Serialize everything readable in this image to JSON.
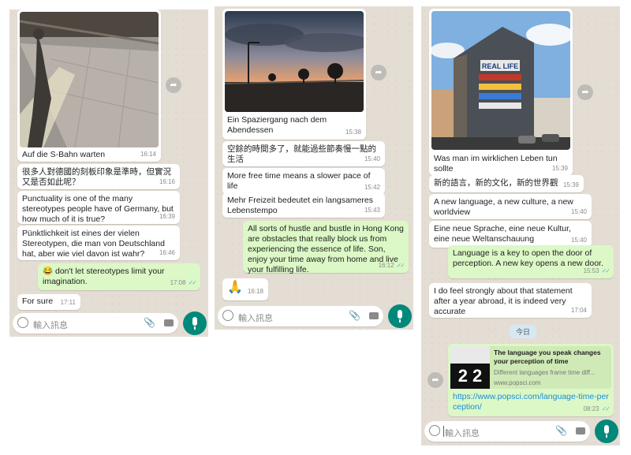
{
  "panel1": {
    "caption": "Auf die S-Bahn warten",
    "caption_time": "16:14",
    "messages": [
      {
        "text": "很多人對德國的刻板印象是準時，但實況又是否如此呢？",
        "time": "16:16"
      },
      {
        "text": "Punctuality is one of the many stereotypes people have of Germany, but how much of it is true?",
        "time": "16:39"
      },
      {
        "text": "Pünktlichkeit ist eines der vielen Stereotypen, die man von Deutschland hat, aber wie viel davon ist wahr?",
        "time": "16:46"
      },
      {
        "text": "😂 don't let stereotypes limit your imagination.",
        "time": "17:08"
      },
      {
        "text": "For sure",
        "time": "17:11"
      }
    ],
    "input_placeholder": "輸入訊息"
  },
  "panel2": {
    "caption": "Ein Spaziergang nach dem Abendessen",
    "caption_time": "15:38",
    "messages": [
      {
        "text": "空餘的時間多了，就能過些節奏慢一點的生活",
        "time": "15:40"
      },
      {
        "text": "More free time means a slower pace of life",
        "time": "15:42"
      },
      {
        "text": "Mehr Freizeit bedeutet ein langsameres Lebenstempo",
        "time": "15:43"
      },
      {
        "text": "All sorts of hustle and bustle in Hong Kong are obstacles that really block us from experiencing the essence of life. Son, enjoy your time away from home and live your fulfilling life.",
        "time": "16:12"
      },
      {
        "text": "🙏",
        "time": "16:18"
      }
    ],
    "input_placeholder": "輸入訊息"
  },
  "panel3": {
    "caption": "Was man im wirklichen Leben tun sollte",
    "caption_time": "15:39",
    "photo_sign": "REAL LIFE",
    "messages": [
      {
        "text": "新的語言，新的文化，新的世界觀",
        "time": "15:39"
      },
      {
        "text": "A new language, a new culture, a new worldview",
        "time": "15:40"
      },
      {
        "text": "Eine neue Sprache, eine neue Kultur, eine neue Weltanschauung",
        "time": "15:40"
      },
      {
        "text": "Language is a key to open the door of perception. A new key opens a new door.",
        "time": "15:53"
      },
      {
        "text": "I do feel strongly about that statement after a year abroad, it is indeed very accurate",
        "time": "17:04"
      }
    ],
    "date_chip": "今日",
    "link": {
      "title": "The language you speak changes your perception of time",
      "desc": "Different languages frame time diff...",
      "domain": "www.popsci.com",
      "url": "https://www.popsci.com/language-time-perception/",
      "time": "08:23",
      "thumb_text": "2 2"
    },
    "input_placeholder": "輸入訊息"
  },
  "colors": {
    "incoming": "#ffffff",
    "outgoing": "#dcf8c6",
    "accent": "#00897b",
    "wallpaper": "#e4ddd4",
    "read_ticks": "#4fb6ec"
  },
  "icons": [
    "share-forward-icon",
    "emoji-icon",
    "attach-icon",
    "camera-icon",
    "mic-icon",
    "read-ticks-icon"
  ]
}
